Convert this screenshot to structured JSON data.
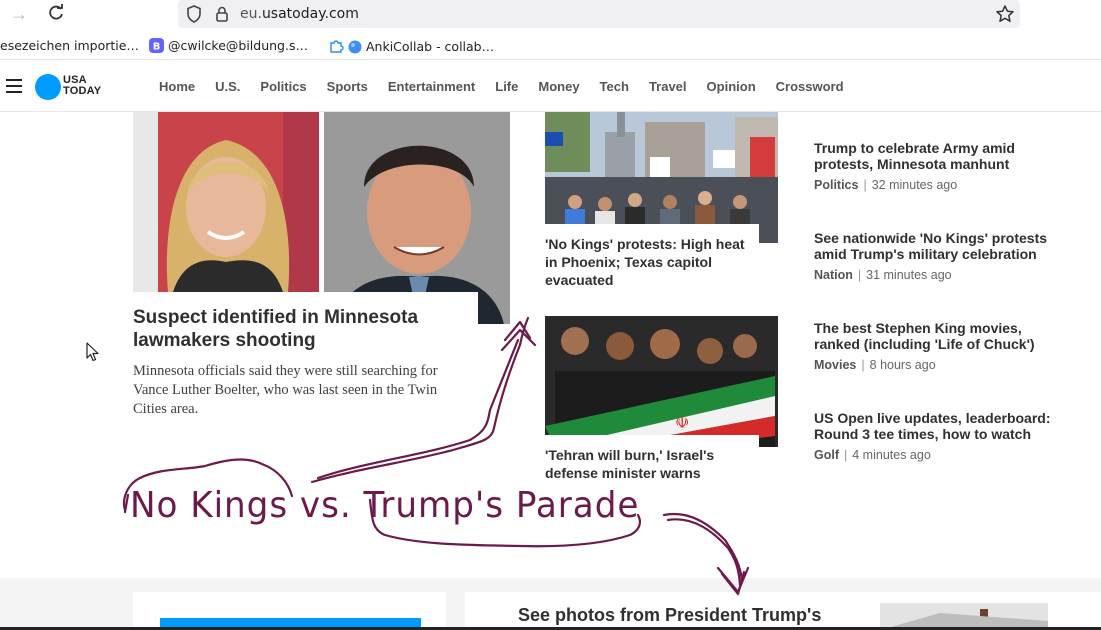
{
  "browser": {
    "url_prefix": "eu.",
    "url_domain": "usatoday.com",
    "bookmarks": [
      {
        "label": "esezeichen importie…"
      },
      {
        "label": "@cwilcke@bildung.s…"
      },
      {
        "label": "AnkiCollab - collab…"
      }
    ]
  },
  "site": {
    "logo_line1": "USA",
    "logo_line2": "TODAY",
    "brand_color": "#009bff",
    "nav": [
      "Home",
      "U.S.",
      "Politics",
      "Sports",
      "Entertainment",
      "Life",
      "Money",
      "Tech",
      "Travel",
      "Opinion",
      "Crossword"
    ]
  },
  "hero": {
    "title": "Suspect identified in Minnesota lawmakers shooting",
    "summary": "Minnesota officials said they were still searching for Vance Luther Boelter, who was last seen in the Twin Cities area."
  },
  "middle": [
    {
      "title": "'No Kings' protests: High heat in Phoenix; Texas capitol evacuated"
    },
    {
      "title": "'Tehran will burn,' Israel's defense minister warns"
    }
  ],
  "right_list": [
    {
      "title": "Trump to celebrate Army amid protests, Minnesota manhunt",
      "category": "Politics",
      "time": "32 minutes ago"
    },
    {
      "title": "See nationwide 'No Kings' protests amid Trump's military celebration",
      "category": "Nation",
      "time": "31 minutes ago"
    },
    {
      "title": "The best Stephen King movies, ranked (including 'Life of Chuck')",
      "category": "Movies",
      "time": "8 hours ago"
    },
    {
      "title": "US Open live updates, leaderboard: Round 3 tee times, how to watch",
      "category": "Golf",
      "time": "4 minutes ago"
    }
  ],
  "annotation": {
    "text": "No Kings vs. Trump's Parade",
    "color": "#6b1a4a"
  },
  "bottom": {
    "title": "See photos from President Trump's"
  }
}
